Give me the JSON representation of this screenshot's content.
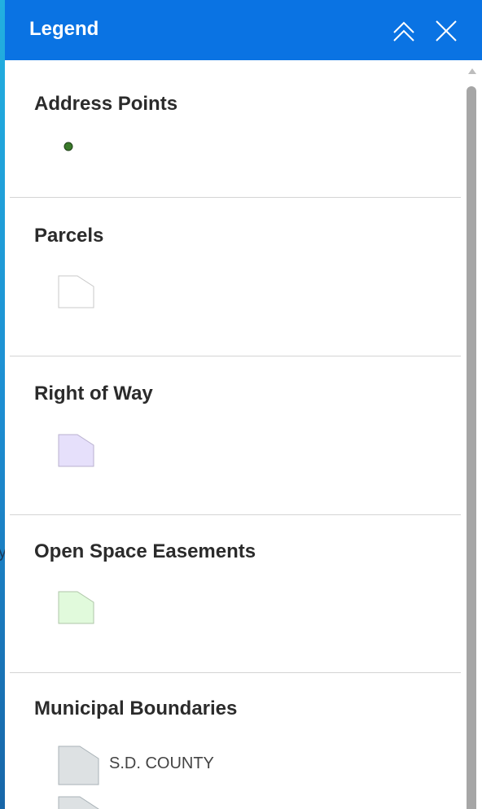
{
  "background": {
    "partial_text": "y"
  },
  "legend_panel": {
    "title": "Legend",
    "header_color": "#0a73e3",
    "buttons": {
      "collapse_icon": "double-chevron-up-icon",
      "close_icon": "close-icon"
    },
    "layers": [
      {
        "name": "Address Points",
        "symbol": "point",
        "fill": "#3a7a2a",
        "outline": "#1f3f18"
      },
      {
        "name": "Parcels",
        "symbol": "polygon",
        "fill": "#ffffff",
        "outline": "#c8c8c8"
      },
      {
        "name": "Right of Way",
        "symbol": "polygon",
        "fill": "#e6e0fb",
        "outline": "#b9b1cf"
      },
      {
        "name": "Open Space Easements",
        "symbol": "polygon",
        "fill": "#e1fadc",
        "outline": "#aec6a8"
      },
      {
        "name": "Municipal Boundaries",
        "symbol": "polygon",
        "classes": [
          {
            "label": "S.D. COUNTY",
            "fill": "#dde1e3",
            "outline": "#a9b2b7"
          },
          {
            "label": "",
            "fill": "#dde1e3",
            "outline": "#a9b2b7"
          }
        ]
      }
    ]
  }
}
